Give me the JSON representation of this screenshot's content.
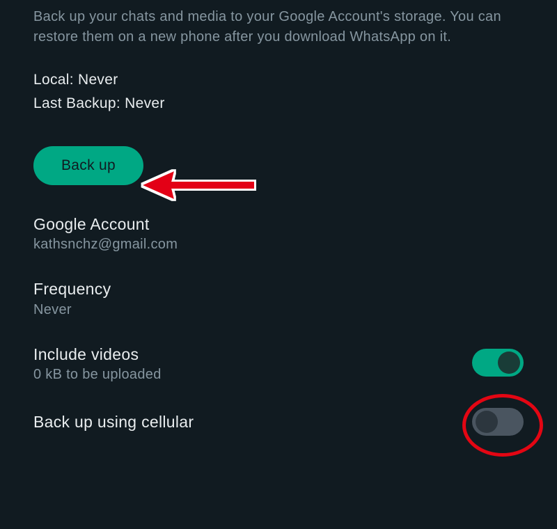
{
  "description": "Back up your chats and media to your Google Account's storage. You can restore them on a new phone after you download WhatsApp on it.",
  "status": {
    "local": "Local: Never",
    "lastBackup": "Last Backup: Never"
  },
  "backupButton": "Back up",
  "sections": {
    "googleAccount": {
      "title": "Google Account",
      "value": "kathsnchz@gmail.com"
    },
    "frequency": {
      "title": "Frequency",
      "value": "Never"
    },
    "includeVideos": {
      "title": "Include videos",
      "sub": "0 kB to be uploaded"
    },
    "backupCellular": {
      "title": "Back up using cellular"
    }
  },
  "annotations": {
    "arrowColor": "#e30613",
    "circleColor": "#e30613"
  }
}
